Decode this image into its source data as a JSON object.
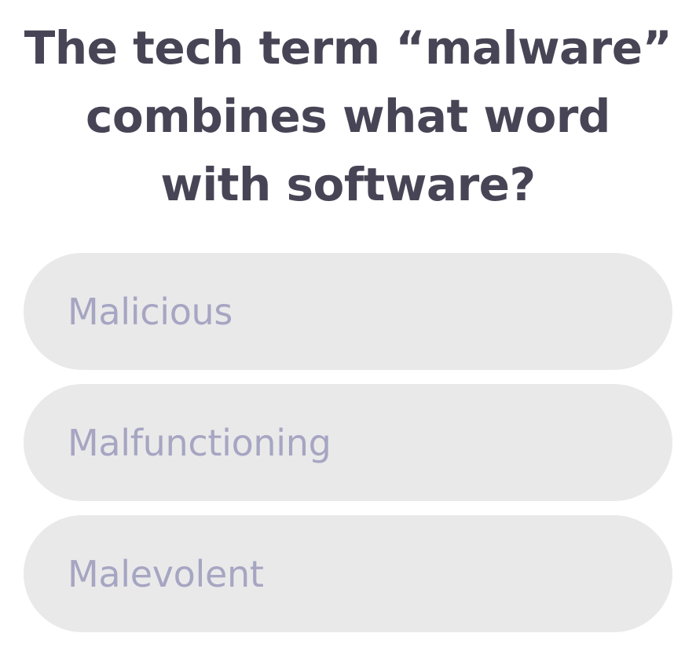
{
  "question": {
    "line1": "The tech term “malware”",
    "line2": "combines what word",
    "line3": "with software?"
  },
  "answers": [
    {
      "label": "Malicious"
    },
    {
      "label": "Malfunctioning"
    },
    {
      "label": "Malevolent"
    }
  ],
  "colors": {
    "question_text": "#474555",
    "answer_background": "#e9e9ea",
    "answer_text": "#a6a5c2",
    "page_background": "#ffffff"
  }
}
